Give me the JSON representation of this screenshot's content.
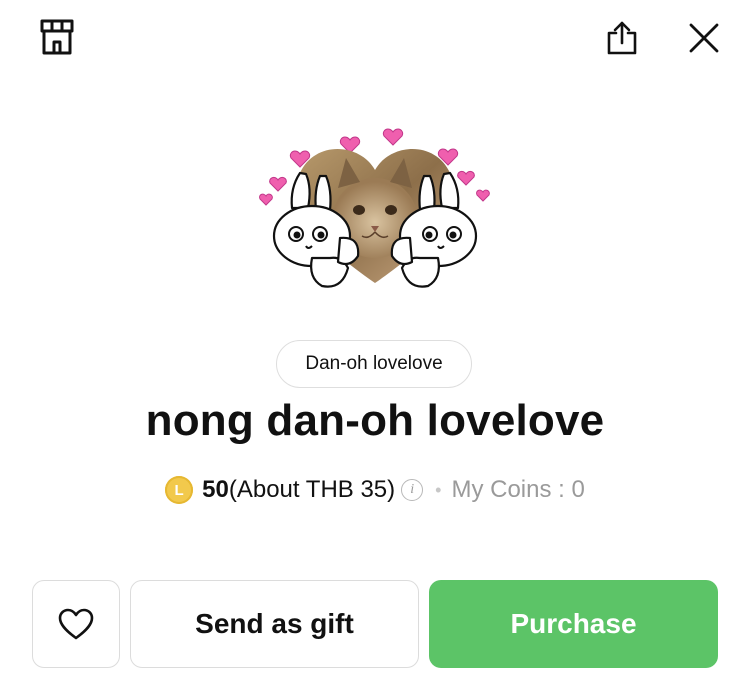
{
  "author": {
    "name": "Dan-oh lovelove"
  },
  "product": {
    "title": "nong dan-oh lovelove"
  },
  "price": {
    "coin_symbol": "L",
    "amount": "50",
    "approx": "(About THB 35)",
    "info_symbol": "i",
    "separator": "•",
    "my_coins": "My Coins : 0"
  },
  "actions": {
    "gift_label": "Send as gift",
    "purchase_label": "Purchase"
  },
  "icons": {
    "shop": "shop-icon",
    "share": "share-icon",
    "close": "close-icon",
    "favorite": "heart-outline-icon"
  },
  "colors": {
    "purchase_green": "#5cc467",
    "coin_gold": "#f2c94c",
    "muted_text": "#9a9a9a"
  }
}
